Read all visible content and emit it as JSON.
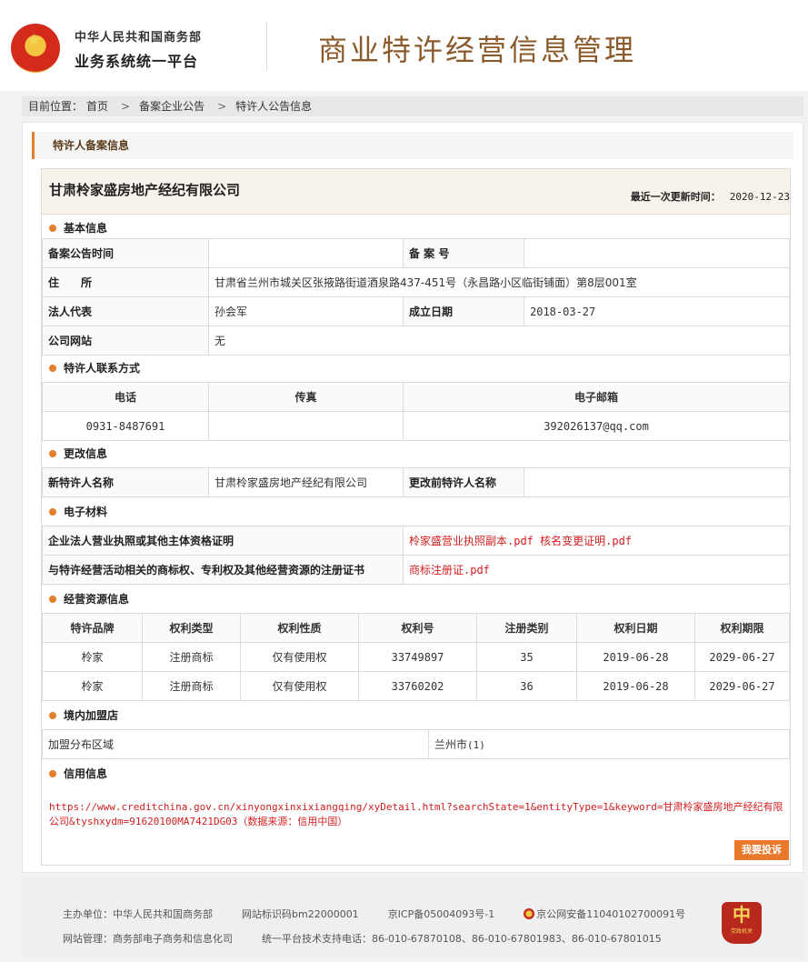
{
  "header": {
    "ministry": "中华人民共和国商务部",
    "platform": "业务系统统一平台",
    "system_title": "商业特许经营信息管理"
  },
  "breadcrumb": {
    "prefix": "目前位置：",
    "items": [
      "首页",
      "备案企业公告",
      "特许人公告信息"
    ],
    "separator": ">"
  },
  "panel": {
    "title": "特许人备案信息",
    "company_name": "甘肃柃家盛房地产经纪有限公司",
    "update_label": "最近一次更新时间：",
    "update_value": "2020-12-23"
  },
  "basic": {
    "title": "基本信息",
    "filing_time_label": "备案公告时间",
    "filing_time_value": "",
    "filing_no_label": "备 案 号",
    "filing_no_value": "",
    "address_label": "住　　所",
    "address_value": "甘肃省兰州市城关区张掖路街道酒泉路437-451号（永昌路小区临街铺面）第8层001室",
    "rep_label": "法人代表",
    "rep_value": "孙会军",
    "founded_label": "成立日期",
    "founded_value": "2018-03-27",
    "website_label": "公司网站",
    "website_value": "无"
  },
  "contact": {
    "title": "特许人联系方式",
    "phone_label": "电话",
    "fax_label": "传真",
    "email_label": "电子邮箱",
    "phone_value": "0931-8487691",
    "fax_value": "",
    "email_value": "392026137@qq.com"
  },
  "change": {
    "title": "更改信息",
    "new_name_label": "新特许人名称",
    "new_name_value": "甘肃柃家盛房地产经纪有限公司",
    "old_name_label": "更改前特许人名称",
    "old_name_value": ""
  },
  "materials": {
    "title": "电子材料",
    "license_label": "企业法人营业执照或其他主体资格证明",
    "license_files": "柃家盛营业执照副本.pdf  核名变更证明.pdf",
    "trademark_label": "与特许经营活动相关的商标权、专利权及其他经营资源的注册证书",
    "trademark_files": "商标注册证.pdf"
  },
  "resources": {
    "title": "经营资源信息",
    "headers": [
      "特许品牌",
      "权利类型",
      "权利性质",
      "权利号",
      "注册类别",
      "权利日期",
      "权利期限"
    ],
    "rows": [
      [
        "柃家",
        "注册商标",
        "仅有使用权",
        "33749897",
        "35",
        "2019-06-28",
        "2029-06-27"
      ],
      [
        "柃家",
        "注册商标",
        "仅有使用权",
        "33760202",
        "36",
        "2019-06-28",
        "2029-06-27"
      ]
    ]
  },
  "stores": {
    "title": "境内加盟店",
    "area_label": "加盟分布区域",
    "area_value": "兰州市",
    "area_count": "(1)"
  },
  "credit": {
    "title": "信用信息",
    "link": "https://www.creditchina.gov.cn/xinyongxinxixiangqing/xyDetail.html?searchState=1&entityType=1&keyword=甘肃柃家盛房地产经纪有限公司&tyshxydm=91620100MA7421DG03（数据来源：信用中国）",
    "complaint_button": "我要投诉"
  },
  "footer": {
    "sponsor": "主办单位：中华人民共和国商务部",
    "site_id": "网站标识码bm22000001",
    "icp": "京ICP备05004093号-1",
    "police": "京公网安备11040102700091号",
    "management": "网站管理：商务部电子商务和信息化司",
    "support": "统一平台技术支持电话：86-010-67870108、86-010-67801983、86-010-67801015",
    "seal_big": "中",
    "seal_small": "党政机关"
  },
  "colors": {
    "accent": "#e27f2d",
    "link_red": "#d21f1f",
    "title_brown": "#8a5a2b"
  }
}
